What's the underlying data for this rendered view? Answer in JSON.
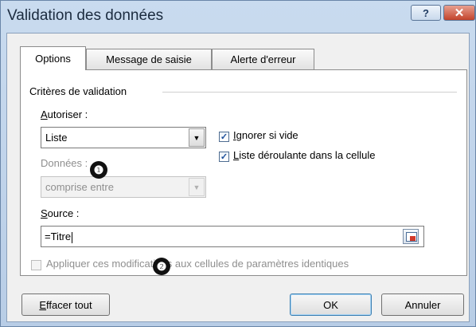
{
  "window": {
    "title": "Validation des données",
    "help_glyph": "?",
    "close_glyph": "✕"
  },
  "tabs": [
    {
      "label": "Options",
      "active": true
    },
    {
      "label": "Message de saisie",
      "active": false
    },
    {
      "label": "Alerte d'erreur",
      "active": false
    }
  ],
  "criteria": {
    "group_label": "Critères de validation",
    "autoriser": {
      "label_mnemonic": "A",
      "label_rest": "utoriser :",
      "value": "Liste"
    },
    "donnees": {
      "label": "Données :",
      "value": "comprise entre"
    },
    "ignore_blank": {
      "mnemonic": "I",
      "label_rest": "gnorer si vide",
      "checked": true
    },
    "in_cell_dropdown": {
      "mnemonic": "L",
      "label_rest": "iste déroulante dans la cellule",
      "checked": true
    },
    "source": {
      "label_mnemonic": "S",
      "label_rest": "ource :",
      "value": "=Titre"
    },
    "apply_all": {
      "label": "Appliquer ces modifications aux cellules de paramètres identiques",
      "checked": false
    }
  },
  "callouts": [
    "❶",
    "❷"
  ],
  "buttons": {
    "clear_mnemonic": "E",
    "clear_rest": "ffacer tout",
    "ok": "OK",
    "cancel": "Annuler"
  },
  "colors": {
    "titlebar": "#c9dbef",
    "close": "#c2432b",
    "check": "#1c4f9b"
  },
  "check_glyph": "✓"
}
